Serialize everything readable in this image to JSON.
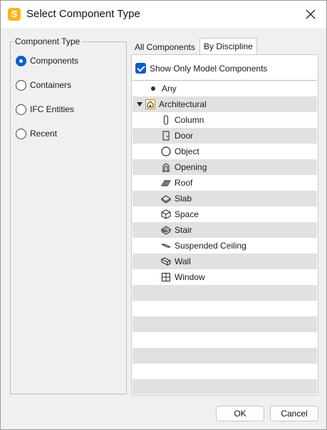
{
  "window": {
    "title": "Select Component Type",
    "app_icon_letter": "S"
  },
  "component_type": {
    "legend": "Component Type",
    "options": [
      {
        "label": "Components",
        "checked": true
      },
      {
        "label": "Containers",
        "checked": false
      },
      {
        "label": "IFC Entities",
        "checked": false
      },
      {
        "label": "Recent",
        "checked": false
      }
    ]
  },
  "tabs": [
    {
      "label": "All Components",
      "active": false
    },
    {
      "label": "By Discipline",
      "active": true
    }
  ],
  "filter": {
    "label": "Show Only Model Components",
    "checked": true
  },
  "tree": {
    "any_label": "Any",
    "group_label": "Architectural",
    "group_expanded": true,
    "items": [
      {
        "label": "Column",
        "icon": "column-icon"
      },
      {
        "label": "Door",
        "icon": "door-icon"
      },
      {
        "label": "Object",
        "icon": "object-icon"
      },
      {
        "label": "Opening",
        "icon": "opening-icon"
      },
      {
        "label": "Roof",
        "icon": "roof-icon"
      },
      {
        "label": "Slab",
        "icon": "slab-icon"
      },
      {
        "label": "Space",
        "icon": "space-icon"
      },
      {
        "label": "Stair",
        "icon": "stair-icon"
      },
      {
        "label": "Suspended Ceiling",
        "icon": "suspended-ceiling-icon"
      },
      {
        "label": "Wall",
        "icon": "wall-icon"
      },
      {
        "label": "Window",
        "icon": "window-icon"
      }
    ]
  },
  "buttons": {
    "ok": "OK",
    "cancel": "Cancel"
  },
  "colors": {
    "accent": "#0a5ec8",
    "app_icon": "#f5b81e",
    "row_shade": "#e1e1e1"
  }
}
